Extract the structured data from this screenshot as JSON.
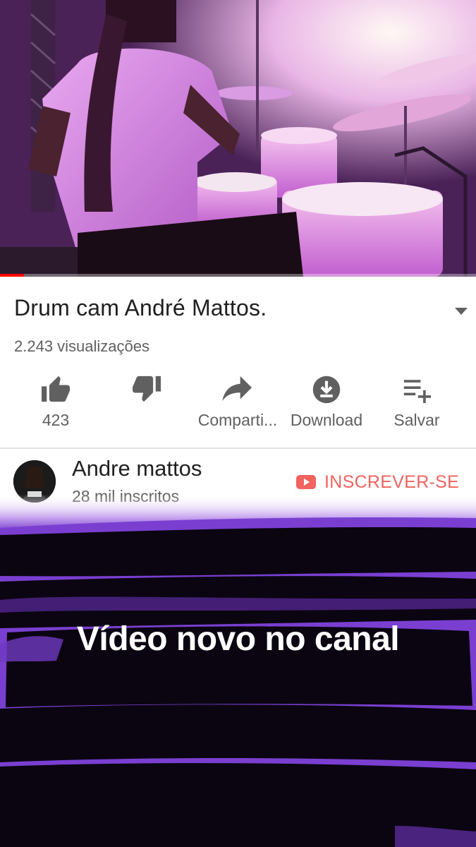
{
  "video": {
    "title": "Drum cam André Mattos.",
    "views": "2.243 visualizações",
    "progress_fraction": 0.05
  },
  "actions": [
    {
      "icon": "thumbs-up-icon",
      "label": "423"
    },
    {
      "icon": "thumbs-down-icon",
      "label": ""
    },
    {
      "icon": "share-icon",
      "label": "Comparti..."
    },
    {
      "icon": "download-icon",
      "label": "Download"
    },
    {
      "icon": "add-to-playlist-icon",
      "label": "Salvar"
    }
  ],
  "channel": {
    "name": "Andre mattos",
    "subscribers": "28 mil inscritos",
    "subscribe_label": "INSCREVER-SE"
  },
  "story": {
    "caption": "Vídeo novo no canal"
  },
  "colors": {
    "subscribe": "#f0635f",
    "progress": "#ff0000",
    "overlay": "#0b0512",
    "overlay_edge": "#7a3fd1"
  }
}
